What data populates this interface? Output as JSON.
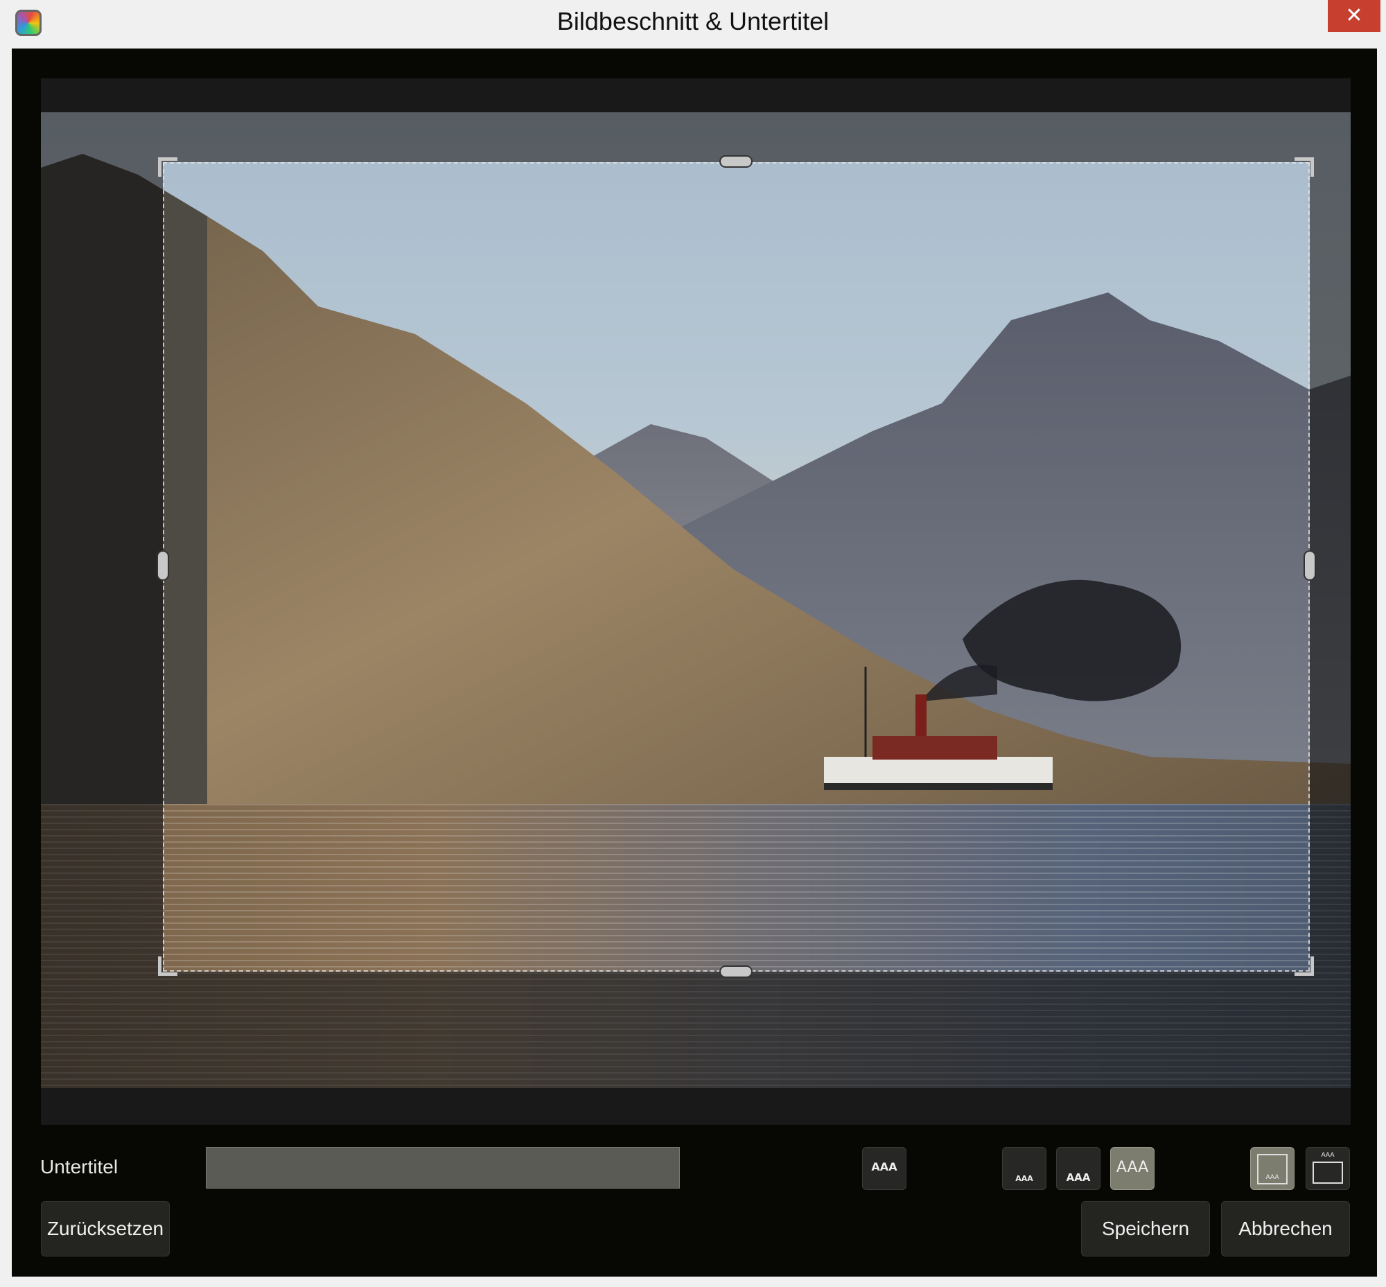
{
  "window": {
    "title": "Bildbeschnitt & Untertitel",
    "close_glyph": "✕"
  },
  "subtitle": {
    "label": "Untertitel",
    "value": "",
    "placeholder": ""
  },
  "format_buttons": [
    {
      "name": "caption-style-outline",
      "glyph": "AAA"
    },
    {
      "name": "caption-position-bottom-small",
      "glyph": "AAA"
    },
    {
      "name": "caption-position-bottom-medium",
      "glyph": "AAA"
    },
    {
      "name": "caption-position-bottom-large",
      "glyph": "AAA",
      "active": true
    },
    {
      "name": "caption-frame-bottom",
      "glyph": "AAA",
      "active": true
    },
    {
      "name": "caption-frame-top",
      "glyph": "AAA"
    }
  ],
  "actions": {
    "reset": "Zurücksetzen",
    "save": "Speichern",
    "cancel": "Abbrechen"
  },
  "colors": {
    "dialog_bg": "#070804",
    "close_bg": "#c7402f",
    "active_button": "#7c7d6f"
  }
}
